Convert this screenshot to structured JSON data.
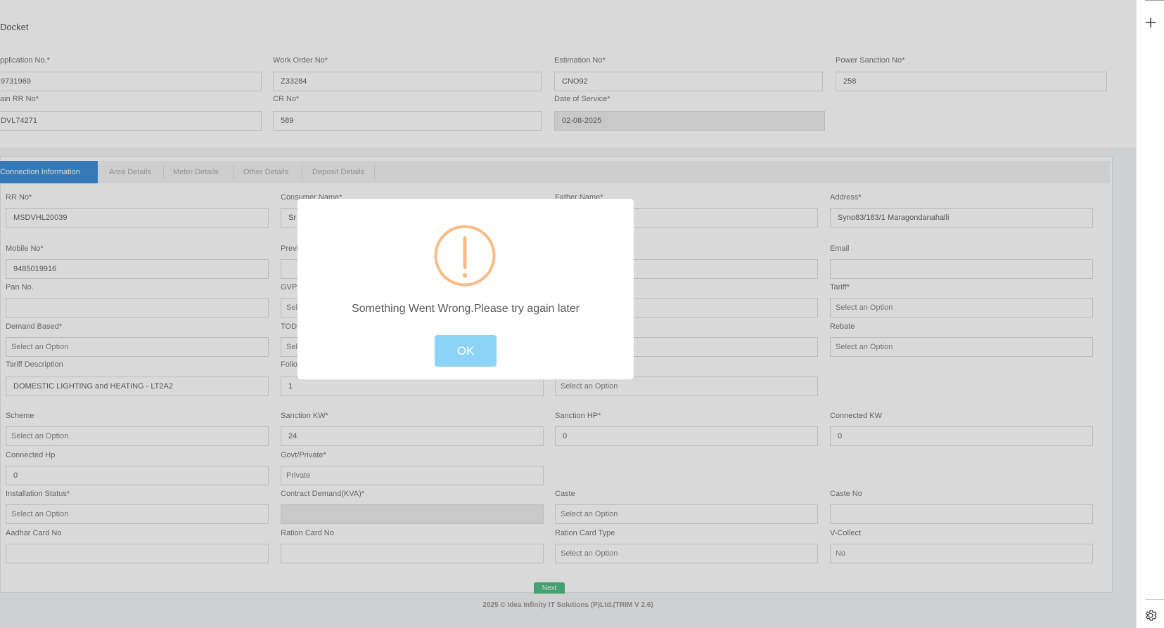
{
  "docket": {
    "title": "Docket",
    "application_no": {
      "label": "pplication No.*",
      "value": "9731969"
    },
    "work_order_no": {
      "label": "Work Order No*",
      "value": "Z33284"
    },
    "estimation_no": {
      "label": "Estimation No*",
      "value": "CNO92"
    },
    "power_sanction_no": {
      "label": "Power Sanction No*",
      "value": "258"
    },
    "main_rr_no": {
      "label": "ain RR No*",
      "value": "DVL74271"
    },
    "cr_no": {
      "label": "CR No*",
      "value": "589"
    },
    "date_of_service": {
      "label": "Date of Service*",
      "value": "02-08-2025"
    }
  },
  "tabs": [
    {
      "label": "Connection Information",
      "active": true
    },
    {
      "label": "Area Details",
      "active": false
    },
    {
      "label": "Meter Details",
      "active": false
    },
    {
      "label": "Other Details",
      "active": false
    },
    {
      "label": "Deposit Details",
      "active": false
    }
  ],
  "form": {
    "rr_no": {
      "label": "RR No*",
      "value": "MSDVHL20039"
    },
    "consumer_name": {
      "label": "Consumer Name*",
      "value": "Sr"
    },
    "father_name": {
      "label": "Father Name*",
      "value": ""
    },
    "address": {
      "label": "Address*",
      "value": "Syno83/183/1 Maragondanahalli"
    },
    "mobile_no": {
      "label": "Mobile No*",
      "value": "9485019916"
    },
    "previous": {
      "label": "Previ",
      "value": ""
    },
    "email": {
      "label": "Email",
      "value": ""
    },
    "pan_no": {
      "label": "Pan No.",
      "value": ""
    },
    "gvp": {
      "label": "GVP*",
      "value": "Sel"
    },
    "tariff": {
      "label": "Tariff*",
      "value": "Select an Option"
    },
    "demand_based": {
      "label": "Demand Based*",
      "value": "Select an Option"
    },
    "tod": {
      "label": "TOD*",
      "value": "Sel"
    },
    "rebate": {
      "label": "Rebate",
      "value": "Select an Option"
    },
    "tariff_description": {
      "label": "Tariff Description",
      "value": "DOMESTIC LIGHTING and HEATING - LT2A2"
    },
    "folio": {
      "label": "Folio",
      "value": "1"
    },
    "col3_row5": {
      "label": "",
      "value": "Select an Option"
    },
    "scheme": {
      "label": "Scheme",
      "value": "Select an Option"
    },
    "sanction_kw": {
      "label": "Sanction KW*",
      "value": "24"
    },
    "sanction_hp": {
      "label": "Sanction HP*",
      "value": "0"
    },
    "connected_kw": {
      "label": "Connected KW",
      "value": "0"
    },
    "connected_hp": {
      "label": "Connected Hp",
      "value": "0"
    },
    "govt_private": {
      "label": "Govt/Private*",
      "value": "Private"
    },
    "installation_status": {
      "label": "Installation Status*",
      "value": "Select an Option"
    },
    "contract_demand": {
      "label": "Contract Demand(KVA)*",
      "value": ""
    },
    "caste": {
      "label": "Caste",
      "value": "Select an Option"
    },
    "caste_no": {
      "label": "Caste No",
      "value": ""
    },
    "aadhar_card_no": {
      "label": "Aadhar Card No",
      "value": ""
    },
    "ration_card_no": {
      "label": "Ration Card No",
      "value": ""
    },
    "ration_card_type": {
      "label": "Ration Card Type",
      "value": "Select an Option"
    },
    "v_collect": {
      "label": "V-Collect",
      "value": "No"
    },
    "next_label": "Next"
  },
  "footer": "2025 © Idea Infinity IT Solutions (P)Ltd.(TRIM V 2.6)",
  "modal": {
    "message": "Something Went Wrong.Please try again later",
    "ok_label": "OK",
    "icon": "warning-icon",
    "accent_color": "#f8bb86",
    "button_color": "#8cd4f5"
  },
  "sidebar": {
    "icons": [
      "plus-icon",
      "gear-icon"
    ]
  }
}
